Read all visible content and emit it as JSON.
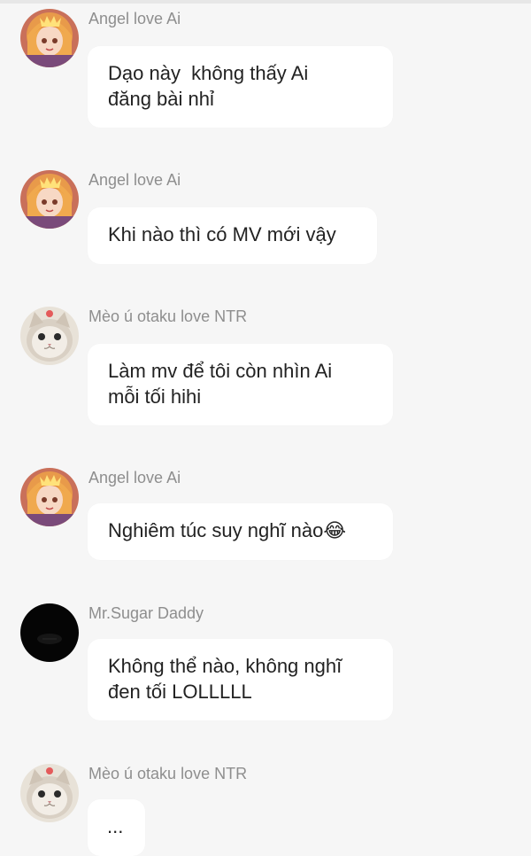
{
  "messages": [
    {
      "sender": "Angel love Ai",
      "avatar": "anime-girl-avatar",
      "text": "Dạo này  không thấy Ai\nđăng bài nhỉ"
    },
    {
      "sender": "Angel love Ai",
      "avatar": "anime-girl-avatar",
      "text": "Khi nào thì có MV mới vậy"
    },
    {
      "sender": "Mèo ú otaku love NTR",
      "avatar": "cat-avatar",
      "text": "Làm mv để tôi còn nhìn Ai\nmỗi tối hihi"
    },
    {
      "sender": "Angel love Ai",
      "avatar": "anime-girl-avatar",
      "text": "Nghiêm túc suy nghĩ nào😂"
    },
    {
      "sender": "Mr.Sugar Daddy",
      "avatar": "dark-avatar",
      "text": "Không thể nào, không nghĩ\nđen tối LOLLLLL"
    },
    {
      "sender": "Mèo ú otaku love NTR",
      "avatar": "cat-avatar",
      "text": "..."
    }
  ],
  "colors": {
    "background": "#f6f6f6",
    "bubble": "#ffffff",
    "sender_text": "#8e8e8e",
    "message_text": "#222222"
  }
}
